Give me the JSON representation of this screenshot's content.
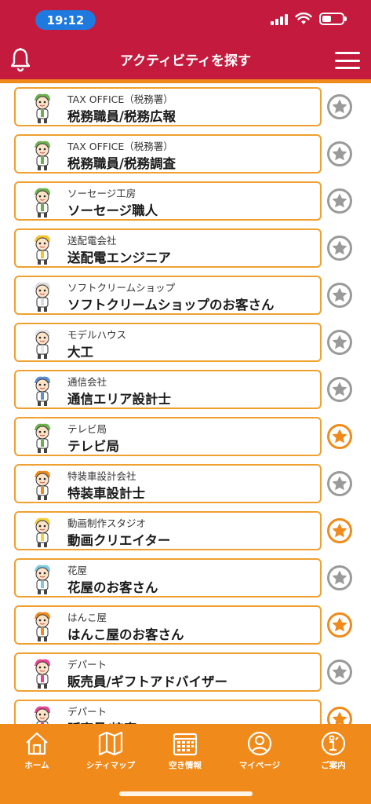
{
  "status_bar": {
    "time": "19:12"
  },
  "header": {
    "title": "アクティビティを探す"
  },
  "activities": [
    {
      "company": "TAX OFFICE（税務署）",
      "job": "税務職員/税務広報",
      "favorite": false,
      "avatar_color": "#6ab04c"
    },
    {
      "company": "TAX OFFICE（税務署）",
      "job": "税務職員/税務調査",
      "favorite": false,
      "avatar_color": "#6ab04c"
    },
    {
      "company": "ソーセージ工房",
      "job": "ソーセージ職人",
      "favorite": false,
      "avatar_color": "#6ab04c"
    },
    {
      "company": "送配電会社",
      "job": "送配電エンジニア",
      "favorite": false,
      "avatar_color": "#f4c430"
    },
    {
      "company": "ソフトクリームショップ",
      "job": "ソフトクリームショップのお客さん",
      "favorite": false,
      "avatar_color": "#dcdcdc"
    },
    {
      "company": "モデルハウス",
      "job": "大工",
      "favorite": false,
      "avatar_color": "#e8e8e8"
    },
    {
      "company": "通信会社",
      "job": "通信エリア設計士",
      "favorite": false,
      "avatar_color": "#5b8fd1"
    },
    {
      "company": "テレビ局",
      "job": "テレビ局",
      "favorite": true,
      "avatar_color": "#6ab04c"
    },
    {
      "company": "特装車設計会社",
      "job": "特装車設計士",
      "favorite": false,
      "avatar_color": "#f08a1a"
    },
    {
      "company": "動画制作スタジオ",
      "job": "動画クリエイター",
      "favorite": true,
      "avatar_color": "#f4d03f"
    },
    {
      "company": "花屋",
      "job": "花屋のお客さん",
      "favorite": false,
      "avatar_color": "#7ec8e3"
    },
    {
      "company": "はんこ屋",
      "job": "はんこ屋のお客さん",
      "favorite": true,
      "avatar_color": "#f08a1a"
    },
    {
      "company": "デパート",
      "job": "販売員/ギフトアドバイザー",
      "favorite": false,
      "avatar_color": "#e84393"
    },
    {
      "company": "デパート",
      "job": "販売員/接客",
      "favorite": true,
      "avatar_color": "#e84393"
    }
  ],
  "bottom_nav": [
    {
      "label": "ホーム",
      "icon": "home-icon"
    },
    {
      "label": "シティマップ",
      "icon": "map-icon"
    },
    {
      "label": "空き情報",
      "icon": "calendar-icon"
    },
    {
      "label": "マイページ",
      "icon": "user-icon"
    },
    {
      "label": "ご案内",
      "icon": "info-icon"
    }
  ],
  "colors": {
    "header": "#c41a3e",
    "accent": "#f08a1a",
    "star_on": "#f08a1a",
    "star_off": "#9a9a9a"
  }
}
